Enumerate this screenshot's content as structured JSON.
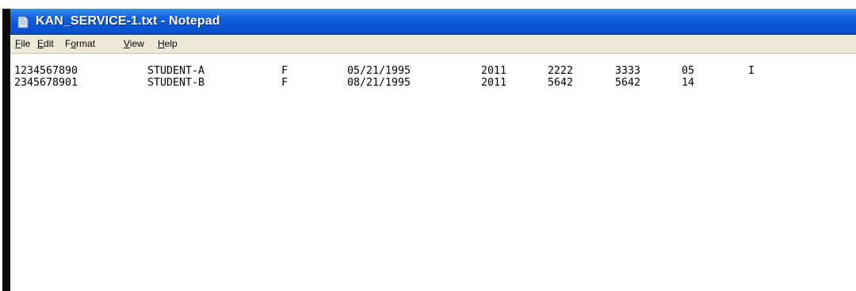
{
  "window": {
    "title": "KAN_SERVICE-1.txt - Notepad",
    "app_icon": "notepad-icon"
  },
  "menu": {
    "items": [
      {
        "mnemonic": "F",
        "rest": "ile"
      },
      {
        "mnemonic": "E",
        "rest": "dit"
      },
      {
        "pre": "F",
        "mnemonic": "o",
        "rest": "rmat"
      },
      {
        "mnemonic": "V",
        "rest": "iew"
      },
      {
        "mnemonic": "H",
        "rest": "elp"
      }
    ]
  },
  "document": {
    "lines": [
      [
        "1234567890",
        "STUDENT-A",
        "F",
        "05/21/1995",
        "2011",
        "2222",
        "3333",
        "05",
        "I"
      ],
      [
        "2345678901",
        "STUDENT-B",
        "F",
        "08/21/1995",
        "2011",
        "5642",
        "5642",
        "14",
        ""
      ]
    ]
  },
  "colors": {
    "titlebar": "#0a58d8",
    "menubar": "#ece9d8",
    "frame": "#0b0b0b"
  }
}
